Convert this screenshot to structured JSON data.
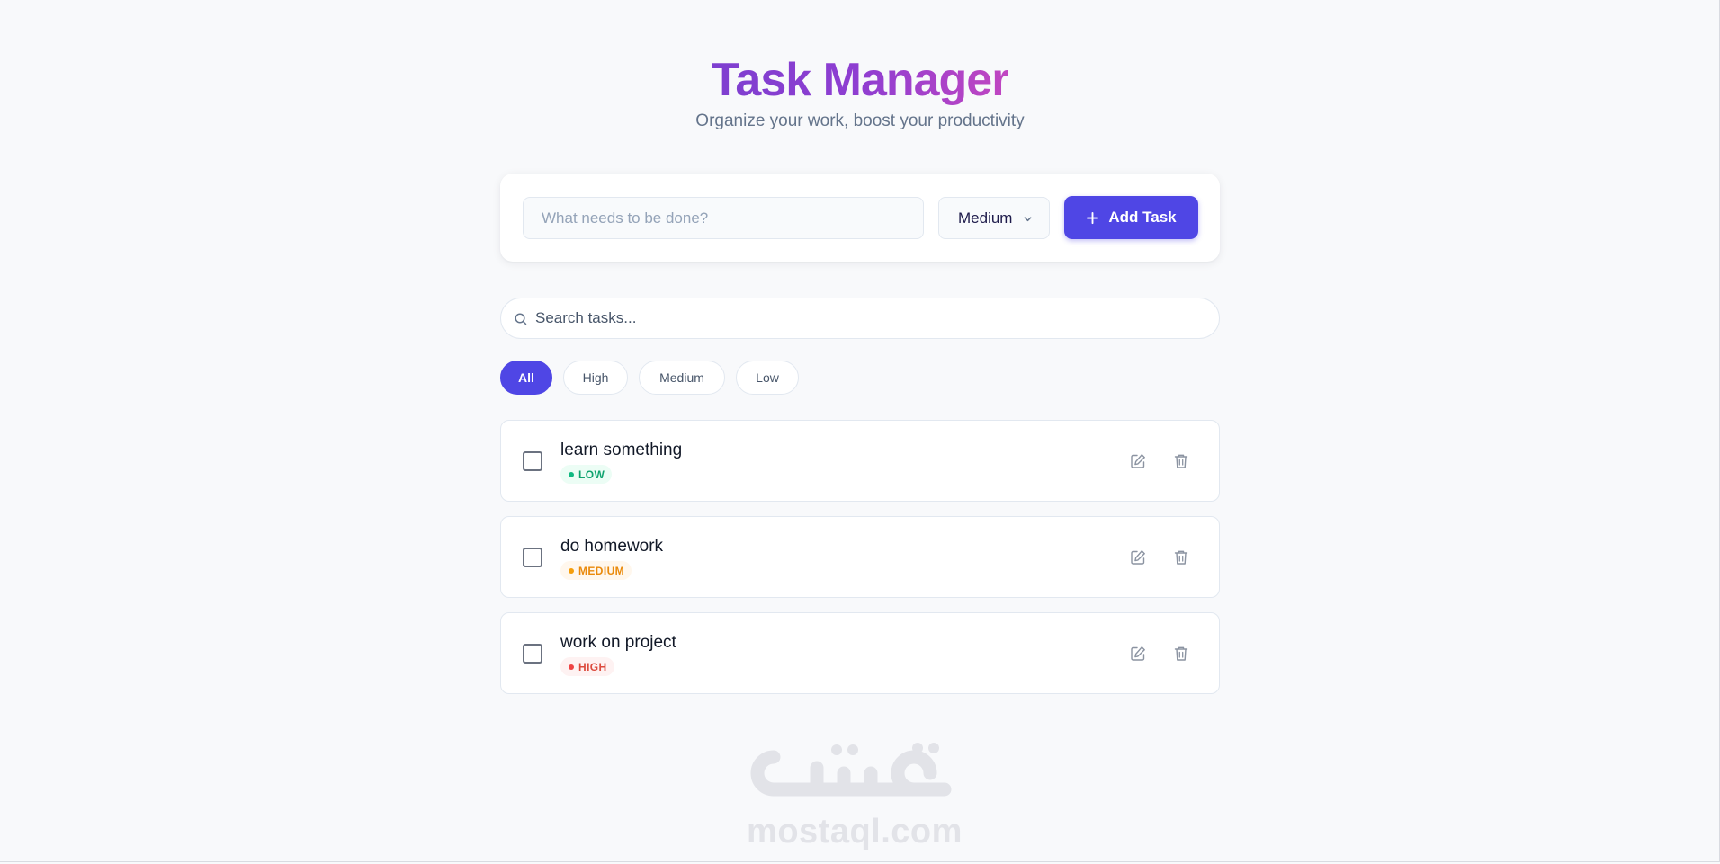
{
  "header": {
    "title": "Task Manager",
    "subtitle": "Organize your work, boost your productivity"
  },
  "add_form": {
    "input_placeholder": "What needs to be done?",
    "input_value": "",
    "priority_selected": "Medium",
    "add_button_label": "Add Task"
  },
  "search": {
    "placeholder": "Search tasks...",
    "value": ""
  },
  "filters": [
    {
      "label": "All",
      "active": true
    },
    {
      "label": "High",
      "active": false
    },
    {
      "label": "Medium",
      "active": false
    },
    {
      "label": "Low",
      "active": false
    }
  ],
  "tasks": [
    {
      "name": "learn something",
      "priority": "LOW",
      "completed": false
    },
    {
      "name": "do homework",
      "priority": "MEDIUM",
      "completed": false
    },
    {
      "name": "work on project",
      "priority": "HIGH",
      "completed": false
    }
  ],
  "watermark": {
    "text": "mostaql.com",
    "logo_text": "مستقل"
  },
  "colors": {
    "accent": "#4f46e5",
    "title_gradient_start": "#7e3fd0",
    "title_gradient_end": "#c146c1",
    "priority_low": "#10b981",
    "priority_medium": "#f59e0b",
    "priority_high": "#ef4444"
  },
  "icons": {
    "add": "plus-icon",
    "select": "chevron-down-icon",
    "search": "search-icon",
    "edit": "edit-icon",
    "delete": "trash-icon"
  }
}
